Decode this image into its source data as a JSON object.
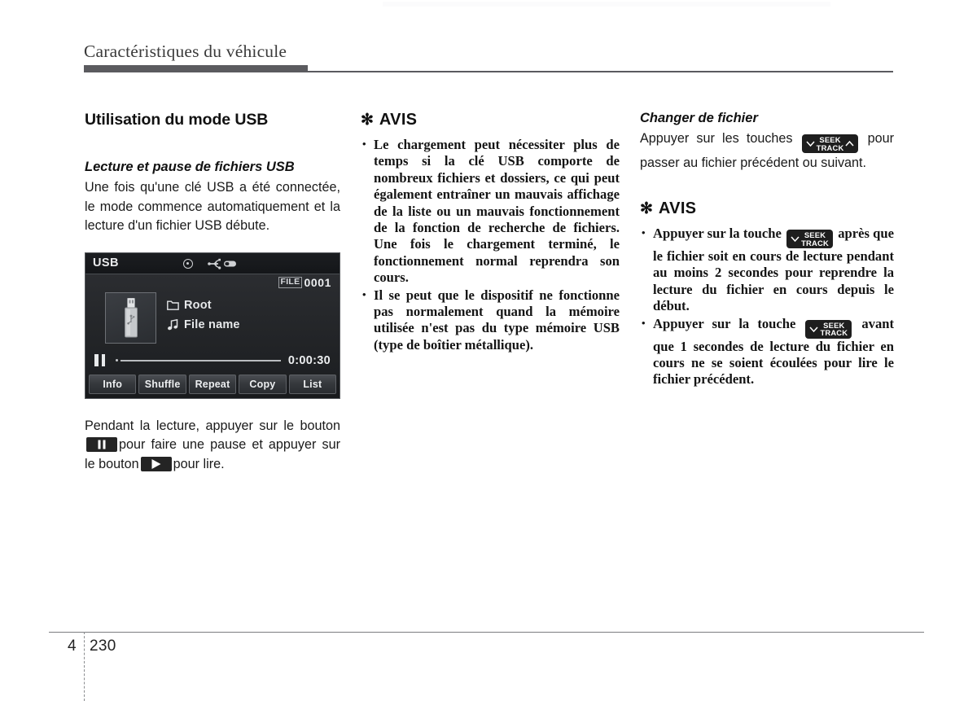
{
  "header": {
    "title": "Caractéristiques du véhicule"
  },
  "left_column": {
    "section_title": "Utilisation du mode USB",
    "sub_title": "Lecture et pause de fichiers USB",
    "intro_paragraph": "Une fois qu'une clé USB a été connectée, le mode commence automatiquement et la lecture d'un fichier USB débute.",
    "usb_screen": {
      "source_label": "USB",
      "disc_icon": "disc-icon",
      "usb_plug_icon": "usb-plug-icon",
      "file_tag": "FILE",
      "file_number": "0001",
      "thumbnail_icon": "usb-flash-drive-icon",
      "folder_icon": "folder-icon",
      "folder_name": "Root",
      "music_icon": "music-note-icon",
      "track_name": "File name",
      "transport_state_icon": "pause-icon",
      "elapsed_time": "0:00:30",
      "buttons": [
        "Info",
        "Shuffle",
        "Repeat",
        "Copy",
        "List"
      ]
    },
    "caption_part1": "Pendant la lecture, appuyer sur le bouton",
    "caption_part2": "pour faire une pause et appuyer sur le bouton",
    "caption_part3": "pour lire."
  },
  "middle_column": {
    "avis_star": "✻",
    "avis_word": "AVIS",
    "notes": [
      "Le chargement peut nécessiter plus de temps si la clé USB comporte de nombreux fichiers et dossiers, ce qui peut également entraîner un mauvais affichage de la liste ou un mauvais fonctionnement de la fonction de recherche de fichiers. Une fois le chargement terminé, le fonctionnement normal reprendra son cours.",
      "Il se peut que le dispositif ne fonctionne pas normalement quand la mémoire utilisée n'est pas du type mémoire USB (type de boîtier métallique)."
    ]
  },
  "right_column": {
    "sub_title": "Changer de fichier",
    "intro_part1": "Appuyer sur les touches",
    "intro_part2": "pour passer au fichier précédent ou suivant.",
    "seek_key": {
      "label_top": "SEEK",
      "label_bottom": "TRACK",
      "chevron_down_icon": "chevron-down-icon",
      "chevron_up_icon": "chevron-up-icon"
    },
    "avis_star": "✻",
    "avis_word": "AVIS",
    "notes": [
      {
        "before_key": "Appuyer sur la touche",
        "after_key": "après que le fichier soit en cours de lecture pendant au moins 2 secondes pour reprendre la lecture du fichier en cours depuis le début."
      },
      {
        "before_key": "Appuyer sur la touche",
        "after_key": "avant que 1 secondes de lecture du fichier en cours ne se soient écoulées pour lire le fichier précédent."
      }
    ]
  },
  "footer": {
    "chapter": "4",
    "page": "230"
  }
}
